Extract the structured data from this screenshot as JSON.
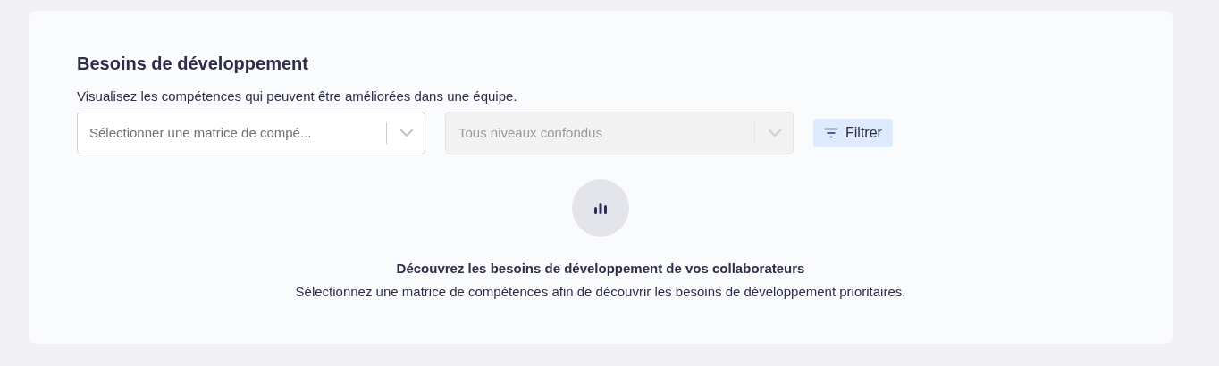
{
  "card": {
    "title": "Besoins de développement",
    "description": "Visualisez les compétences qui peuvent être améliorées dans une équipe.",
    "selects": [
      {
        "placeholder": "Sélectionner une matrice de compé...",
        "disabled": false
      },
      {
        "placeholder": "Tous niveaux confondus",
        "disabled": true
      }
    ],
    "filter_button": "Filtrer",
    "empty_state": {
      "title": "Découvrez les besoins de développement de vos collaborateurs",
      "text": "Sélectionnez une matrice de compétences afin de découvrir les besoins de développement prioritaires."
    }
  }
}
